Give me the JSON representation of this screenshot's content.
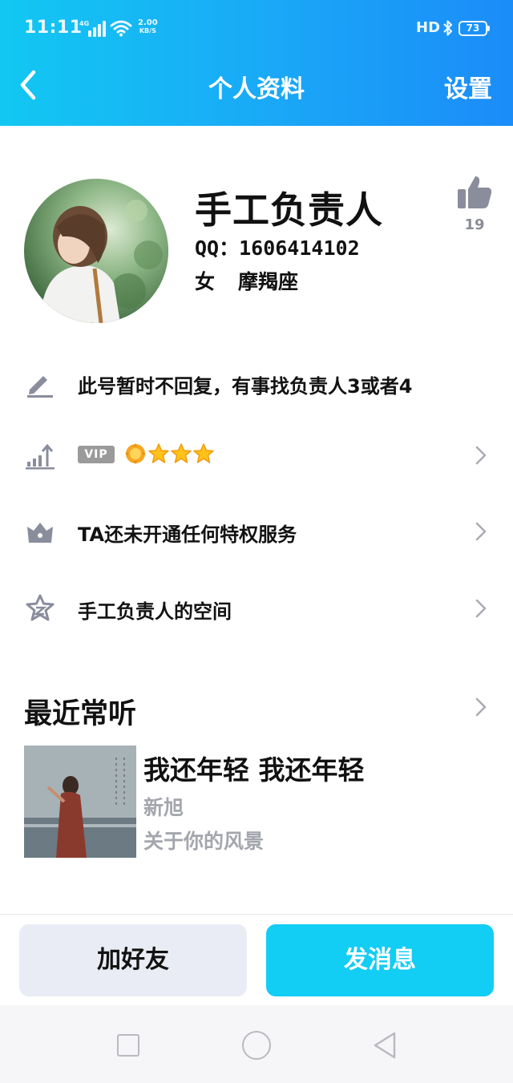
{
  "status_bar": {
    "time": "11:11",
    "network": "4G",
    "speed_value": "2.00",
    "speed_unit": "KB/S",
    "hd": "HD",
    "battery": "73"
  },
  "nav": {
    "title": "个人资料",
    "settings_label": "设置",
    "back_icon": "chevron-left-icon"
  },
  "profile": {
    "name": "手工负责人",
    "qq": "QQ：1606414102",
    "gender": "女",
    "zodiac": "摩羯座",
    "like_count": "19"
  },
  "rows": [
    {
      "icon": "pencil-icon",
      "label": "此号暂时不回复，有事找负责人3或者4",
      "has_chevron": false
    },
    {
      "icon": "level-chart-icon",
      "badge": "VIP",
      "level_icons": [
        "sun-icon",
        "star-icon",
        "star-icon",
        "star-icon"
      ],
      "has_chevron": true
    },
    {
      "icon": "crown-icon",
      "label": "TA还未开通任何特权服务",
      "has_chevron": true
    },
    {
      "icon": "space-star-icon",
      "label": "手工负责人的空间",
      "has_chevron": true
    }
  ],
  "recent": {
    "title": "最近常听",
    "song_title": "我还年轻 我还年轻",
    "artist": "新旭",
    "album": "关于你的风景"
  },
  "actions": {
    "add_friend": "加好友",
    "send_message": "发消息"
  },
  "colors": {
    "header_start": "#12c8f2",
    "header_end": "#1b8cf8",
    "primary_button": "#12cdf4",
    "secondary_button": "#eaecf5",
    "muted_text": "#a4a6ad",
    "icon_gray": "#8a8d9c"
  }
}
